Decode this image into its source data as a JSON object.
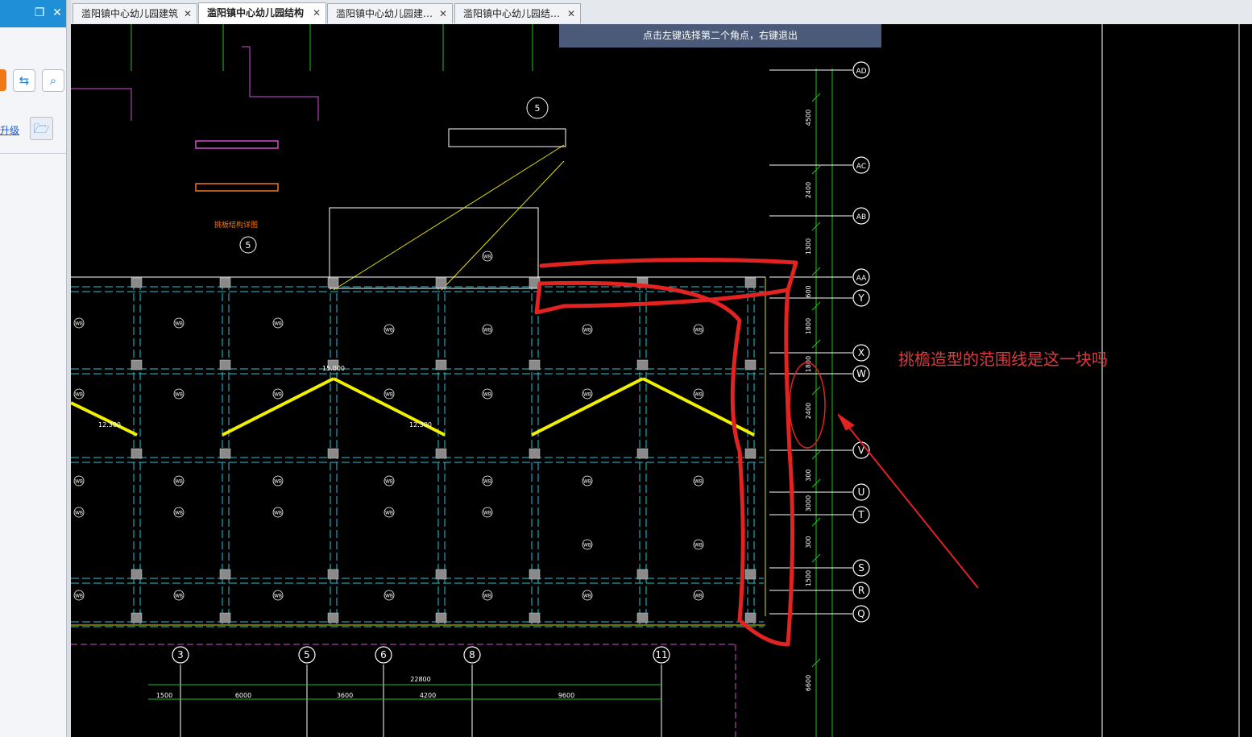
{
  "left_panel": {
    "restore_icon": "restore-window-icon",
    "close_icon": "close-icon",
    "sync_icon": "sync-icon",
    "search_icon": "search-icon",
    "link_text": "升级",
    "folder_icon": "folder-open-icon"
  },
  "tabs": [
    {
      "label": "滥阳镇中心幼儿园建筑",
      "active": false
    },
    {
      "label": "滥阳镇中心幼儿园结构",
      "active": true
    },
    {
      "label": "滥阳镇中心幼儿园建…",
      "active": false
    },
    {
      "label": "滥阳镇中心幼儿园结…",
      "active": false
    }
  ],
  "status_tip": "点击左键选择第二个角点，右键退出",
  "annotation": "挑檐造型的范围线是这一块吗",
  "drawing": {
    "axis_right": [
      "AD",
      "AC",
      "AB",
      "AA",
      "Y",
      "X",
      "W",
      "V",
      "U",
      "T",
      "S",
      "R",
      "Q"
    ],
    "dims_right": [
      "4500",
      "2400",
      "1300",
      "600",
      "1800",
      "1800",
      "2400",
      "300",
      "3000",
      "300",
      "1500",
      "6600"
    ],
    "axis_bottom": [
      "3",
      "5",
      "6",
      "8",
      "11"
    ],
    "dims_bottom": [
      "1500",
      "6000",
      "3600",
      "4200",
      "9600"
    ],
    "dim_total": "22800",
    "slab_label": "WB",
    "detail_title": "挑板结构详图",
    "detail_no": "5",
    "levels": [
      "15.000",
      "12.300",
      "12.300"
    ],
    "colors": {
      "accent": "#1f8fd8",
      "annotation": "#e23a3a",
      "cad_bg": "#000000"
    }
  }
}
